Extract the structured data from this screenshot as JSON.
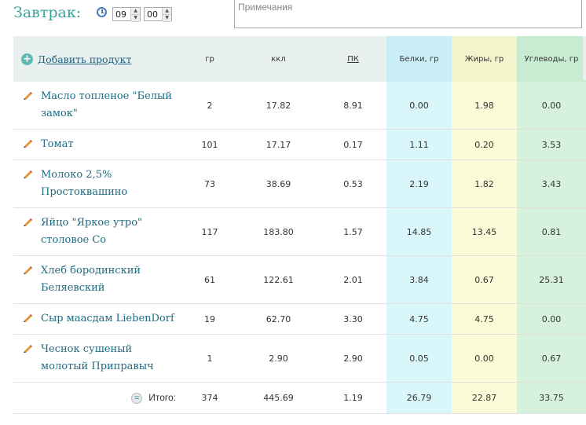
{
  "meal": {
    "title": "Завтрак:",
    "hour": "09",
    "minute": "00"
  },
  "notes": {
    "placeholder": "Примечания"
  },
  "header": {
    "add_product": "Добавить продукт",
    "grams": "гр",
    "kcal": "ккл",
    "pk": "ПК",
    "protein": "Белки, гр",
    "fat": "Жиры, гр",
    "carbs": "Углеводы, гр"
  },
  "colors": {
    "protein_bg": "#d9f6fb",
    "fat_bg": "#fbfbd8",
    "carbs_bg": "#d6f2dd",
    "link": "#1f6a80",
    "title": "#39a39a"
  },
  "rows": [
    {
      "name": "Масло топленое \"Белый замок\"",
      "grams": "2",
      "kcal": "17.82",
      "pk": "8.91",
      "protein": "0.00",
      "fat": "1.98",
      "carbs": "0.00"
    },
    {
      "name": "Томат",
      "grams": "101",
      "kcal": "17.17",
      "pk": "0.17",
      "protein": "1.11",
      "fat": "0.20",
      "carbs": "3.53"
    },
    {
      "name": "Молоко 2,5% Простоквашино",
      "grams": "73",
      "kcal": "38.69",
      "pk": "0.53",
      "protein": "2.19",
      "fat": "1.82",
      "carbs": "3.43"
    },
    {
      "name": "Яйцо \"Яркое утро\" столовое Со",
      "grams": "117",
      "kcal": "183.80",
      "pk": "1.57",
      "protein": "14.85",
      "fat": "13.45",
      "carbs": "0.81"
    },
    {
      "name": "Хлеб бородинский Беляевский",
      "grams": "61",
      "kcal": "122.61",
      "pk": "2.01",
      "protein": "3.84",
      "fat": "0.67",
      "carbs": "25.31"
    },
    {
      "name": "Сыр маасдам LiebenDorf",
      "grams": "19",
      "kcal": "62.70",
      "pk": "3.30",
      "protein": "4.75",
      "fat": "4.75",
      "carbs": "0.00"
    },
    {
      "name": "Чеснок сушеный молотый Приправыч",
      "grams": "1",
      "kcal": "2.90",
      "pk": "2.90",
      "protein": "0.05",
      "fat": "0.00",
      "carbs": "0.67"
    }
  ],
  "total": {
    "label": "Итого:",
    "grams": "374",
    "kcal": "445.69",
    "pk": "1.19",
    "protein": "26.79",
    "fat": "22.87",
    "carbs": "33.75"
  }
}
